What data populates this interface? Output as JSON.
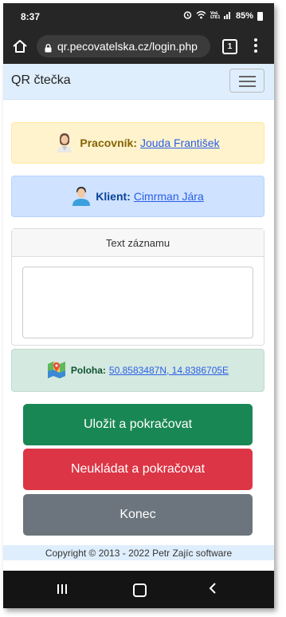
{
  "status_bar": {
    "time": "8:37",
    "battery": "85%",
    "icons": [
      "alarm-icon",
      "wifi-icon",
      "volte-icon",
      "signal-icon",
      "battery-icon"
    ]
  },
  "browser": {
    "url": "qr.pecovatelska.cz/login.php",
    "tab_count": "1"
  },
  "navbar": {
    "brand": "QR čtečka"
  },
  "worker": {
    "label": "Pracovník:",
    "name": "Jouda František"
  },
  "client": {
    "label": "Klient:",
    "name": "Cimrman Jára"
  },
  "record": {
    "header": "Text záznamu",
    "value": ""
  },
  "location": {
    "label": "Poloha:",
    "coords": "50.8583487N, 14.8386705E"
  },
  "buttons": {
    "save": "Uložit a pokračovat",
    "nosave": "Neukládat a pokračovat",
    "end": "Konec"
  },
  "footer": {
    "text": "Copyright © 2013 - 2022 Petr Zajíc software"
  },
  "colors": {
    "success": "#198754",
    "danger": "#dc3545",
    "secondary": "#6c757d",
    "navbar_bg": "#dfeefc"
  }
}
